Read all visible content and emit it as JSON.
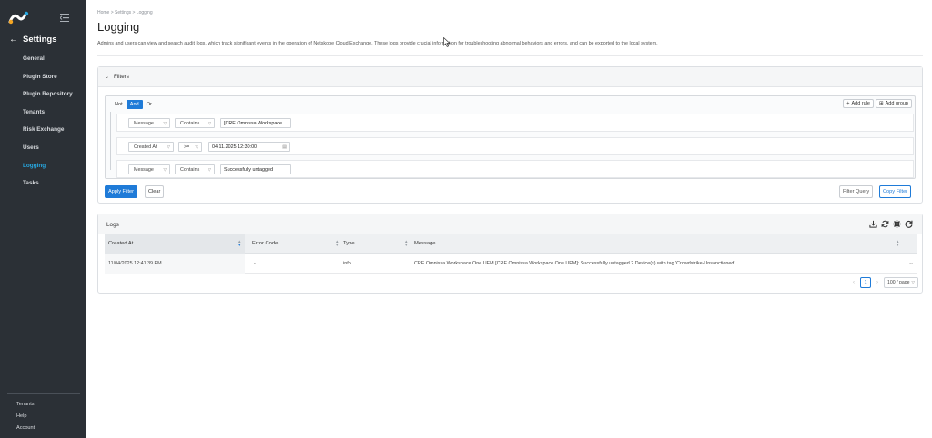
{
  "sidebar": {
    "back_title": "Settings",
    "items": [
      {
        "label": "General"
      },
      {
        "label": "Plugin Store"
      },
      {
        "label": "Plugin Repository"
      },
      {
        "label": "Tenants"
      },
      {
        "label": "Risk Exchange"
      },
      {
        "label": "Users"
      },
      {
        "label": "Logging",
        "active": true
      },
      {
        "label": "Tasks"
      }
    ],
    "bottom_links": [
      {
        "label": "Tenants"
      },
      {
        "label": "Help"
      },
      {
        "label": "Account"
      }
    ]
  },
  "header": {
    "breadcrumb": "Home > Settings > Logging",
    "title": "Logging",
    "description": "Admins and users can view and search audit logs, which track significant events in the operation of Netskope Cloud Exchange. These logs provide crucial information for troubleshooting abnormal behaviors and errors, and can be exported to the local system."
  },
  "filters": {
    "title": "Filters",
    "conjunctions": [
      "Not",
      "And",
      "Or"
    ],
    "selected_conjunction": "And",
    "add_rule": "Add rule",
    "add_group": "Add group",
    "rules": [
      {
        "field": "Message",
        "operator": "Contains",
        "value": "[CRE Omnissa Workspace"
      },
      {
        "field": "Created At",
        "operator": ">=",
        "value": "04.11.2025 12:30:00"
      },
      {
        "field": "Message",
        "operator": "Contains",
        "value": "Successfully untagged"
      }
    ],
    "apply_label": "Apply Filter",
    "clear_label": "Clear",
    "filter_query_label": "Filter Query",
    "copy_filter_label": "Copy Filter"
  },
  "logs": {
    "title": "Logs",
    "columns": [
      "Created At",
      "Error Code",
      "Type",
      "Message"
    ],
    "rows": [
      {
        "created_at": "11/04/2025 12:41:39 PM",
        "error_code": "-",
        "type": "info",
        "message": "CRE Omnissa Workspace One UEM [CRE Omnissa Workspace One UEM]: Successfully untagged 2 Device(s) with tag 'Crowdstrike-Unsanctioned'."
      }
    ],
    "pagination": {
      "current_page": "1",
      "page_size": "100 / page"
    }
  },
  "colors": {
    "sidebar_bg": "#2b3036",
    "accent": "#1f7bd8",
    "active_nav": "#27a7e0"
  }
}
